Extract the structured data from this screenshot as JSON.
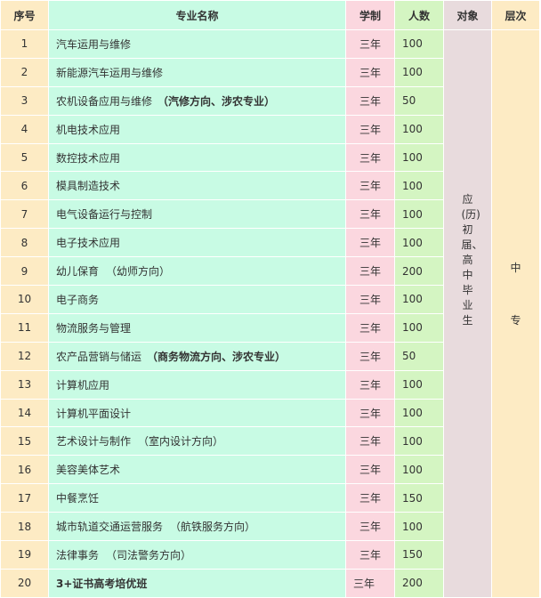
{
  "headers": {
    "seq": "序号",
    "name": "专业名称",
    "duration": "学制",
    "count": "人数",
    "target": "对象",
    "level": "层次"
  },
  "target_text": "应(历)初届、高中毕业生",
  "level_chars": [
    "中",
    "专"
  ],
  "rows": [
    {
      "seq": "1",
      "name": "汽车运用与维修",
      "note": "",
      "sub": "",
      "duration": "三年",
      "count": "100"
    },
    {
      "seq": "2",
      "name": "新能源汽车运用与维修",
      "note": "",
      "sub": "",
      "duration": "三年",
      "count": "100"
    },
    {
      "seq": "3",
      "name": "农机设备应用与维修",
      "note": "（汽修方向、涉农专业）",
      "sub": "",
      "duration": "三年",
      "count": "50"
    },
    {
      "seq": "4",
      "name": "机电技术应用",
      "note": "",
      "sub": "",
      "duration": "三年",
      "count": "100"
    },
    {
      "seq": "5",
      "name": "数控技术应用",
      "note": "",
      "sub": "",
      "duration": "三年",
      "count": "100"
    },
    {
      "seq": "6",
      "name": "模具制造技术",
      "note": "",
      "sub": "",
      "duration": "三年",
      "count": "100"
    },
    {
      "seq": "7",
      "name": "电气设备运行与控制",
      "note": "",
      "sub": "",
      "duration": "三年",
      "count": "100"
    },
    {
      "seq": "8",
      "name": "电子技术应用",
      "note": "",
      "sub": "",
      "duration": "三年",
      "count": "100"
    },
    {
      "seq": "9",
      "name": "幼儿保育",
      "note": "",
      "sub": "（幼师方向）",
      "duration": "三年",
      "count": "200"
    },
    {
      "seq": "10",
      "name": "电子商务",
      "note": "",
      "sub": "",
      "duration": "三年",
      "count": "100"
    },
    {
      "seq": "11",
      "name": "物流服务与管理",
      "note": "",
      "sub": "",
      "duration": "三年",
      "count": "100"
    },
    {
      "seq": "12",
      "name": "农产品营销与储运",
      "note": "（商务物流方向、涉农专业）",
      "sub": "",
      "duration": "三年",
      "count": "50"
    },
    {
      "seq": "13",
      "name": "计算机应用",
      "note": "",
      "sub": "",
      "duration": "三年",
      "count": "100"
    },
    {
      "seq": "14",
      "name": "计算机平面设计",
      "note": "",
      "sub": "",
      "duration": "三年",
      "count": "100"
    },
    {
      "seq": "15",
      "name": "艺术设计与制作",
      "note": "",
      "sub": "（室内设计方向）",
      "duration": "三年",
      "count": "100"
    },
    {
      "seq": "16",
      "name": "美容美体艺术",
      "note": "",
      "sub": "",
      "duration": "三年",
      "count": "100"
    },
    {
      "seq": "17",
      "name": "中餐烹饪",
      "note": "",
      "sub": "",
      "duration": "三年",
      "count": "150"
    },
    {
      "seq": "18",
      "name": "城市轨道交通运营服务",
      "note": "",
      "sub": "（航铁服务方向）",
      "duration": "三年",
      "count": "100"
    },
    {
      "seq": "19",
      "name": "法律事务",
      "note": "",
      "sub": "（司法警务方向）",
      "duration": "三年",
      "count": "150"
    },
    {
      "seq": "20",
      "name": "3+证书高考培优班",
      "note": "",
      "sub": "",
      "duration": "三年",
      "count": "200",
      "bold": true
    }
  ]
}
